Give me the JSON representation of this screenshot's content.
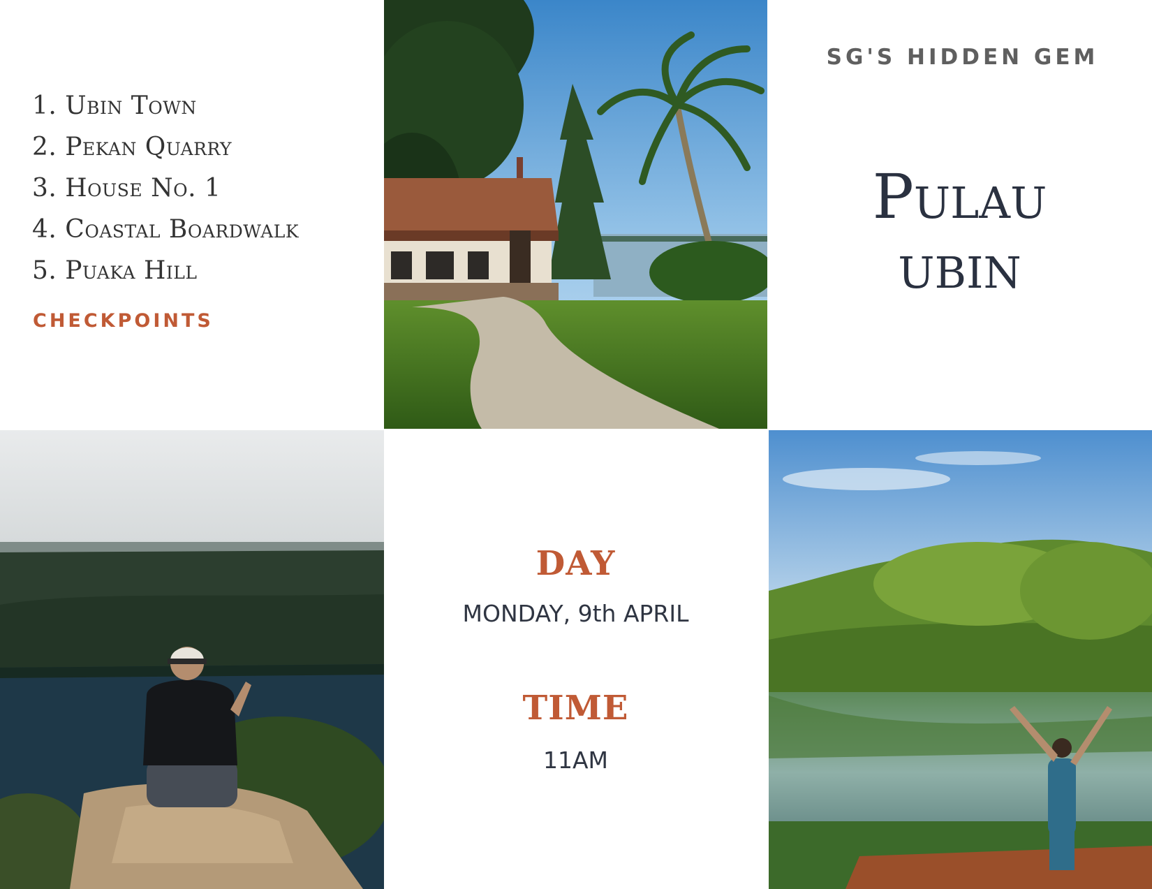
{
  "checkpoints": {
    "items": [
      "1. Ubin Town",
      "2. Pekan Quarry",
      "3. House No. 1",
      "4. Coastal Boardwalk",
      "5. Puaka Hill"
    ],
    "caption": "CHECKPOINTS"
  },
  "header": {
    "kicker": "SG'S HIDDEN GEM",
    "title_line1": "Pulau",
    "title_line2": "ubin"
  },
  "event": {
    "day_label": "DAY",
    "day_value": "MONDAY, 9th APRIL",
    "time_label": "TIME",
    "time_value": "11AM"
  },
  "colors": {
    "accent": "#c05a35",
    "title": "#2a3140",
    "kicker": "#5f5f5f",
    "body_text": "#333333"
  }
}
